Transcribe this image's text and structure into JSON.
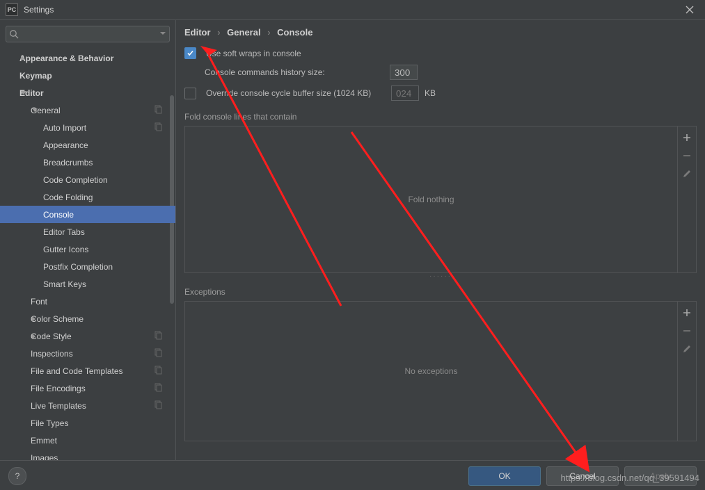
{
  "window": {
    "title": "Settings",
    "app_icon": "PC"
  },
  "search": {
    "placeholder": ""
  },
  "tree": [
    {
      "label": "Appearance & Behavior",
      "level": 1,
      "arrow": "right",
      "bold": true
    },
    {
      "label": "Keymap",
      "level": 1,
      "bold": true
    },
    {
      "label": "Editor",
      "level": 1,
      "arrow": "down",
      "bold": true
    },
    {
      "label": "General",
      "level": 2,
      "arrow": "down",
      "copy": true
    },
    {
      "label": "Auto Import",
      "level": 3,
      "copy": true
    },
    {
      "label": "Appearance",
      "level": 3
    },
    {
      "label": "Breadcrumbs",
      "level": 3
    },
    {
      "label": "Code Completion",
      "level": 3
    },
    {
      "label": "Code Folding",
      "level": 3
    },
    {
      "label": "Console",
      "level": 3,
      "selected": true
    },
    {
      "label": "Editor Tabs",
      "level": 3
    },
    {
      "label": "Gutter Icons",
      "level": 3
    },
    {
      "label": "Postfix Completion",
      "level": 3
    },
    {
      "label": "Smart Keys",
      "level": 3
    },
    {
      "label": "Font",
      "level": 2
    },
    {
      "label": "Color Scheme",
      "level": 2,
      "arrow": "right"
    },
    {
      "label": "Code Style",
      "level": 2,
      "arrow": "right",
      "copy": true
    },
    {
      "label": "Inspections",
      "level": 2,
      "copy": true
    },
    {
      "label": "File and Code Templates",
      "level": 2,
      "copy": true
    },
    {
      "label": "File Encodings",
      "level": 2,
      "copy": true
    },
    {
      "label": "Live Templates",
      "level": 2,
      "copy": true
    },
    {
      "label": "File Types",
      "level": 2
    },
    {
      "label": "Emmet",
      "level": 2
    },
    {
      "label": "Images",
      "level": 2
    }
  ],
  "breadcrumb": [
    "Editor",
    "General",
    "Console"
  ],
  "options": {
    "soft_wraps": {
      "label": "Use soft wraps in console",
      "checked": true
    },
    "history_size": {
      "label": "Console commands history size:",
      "value": "300"
    },
    "override_buffer": {
      "label": "Override console cycle buffer size (1024 KB)",
      "checked": false,
      "value": "024",
      "suffix": "KB"
    }
  },
  "sections": {
    "fold": {
      "title": "Fold console lines that contain",
      "empty": "Fold nothing"
    },
    "exceptions": {
      "title": "Exceptions",
      "empty": "No exceptions"
    }
  },
  "buttons": {
    "ok": "OK",
    "cancel": "Cancel",
    "apply": "Apply",
    "help": "?"
  },
  "watermark": "https://blog.csdn.net/qq_39591494"
}
